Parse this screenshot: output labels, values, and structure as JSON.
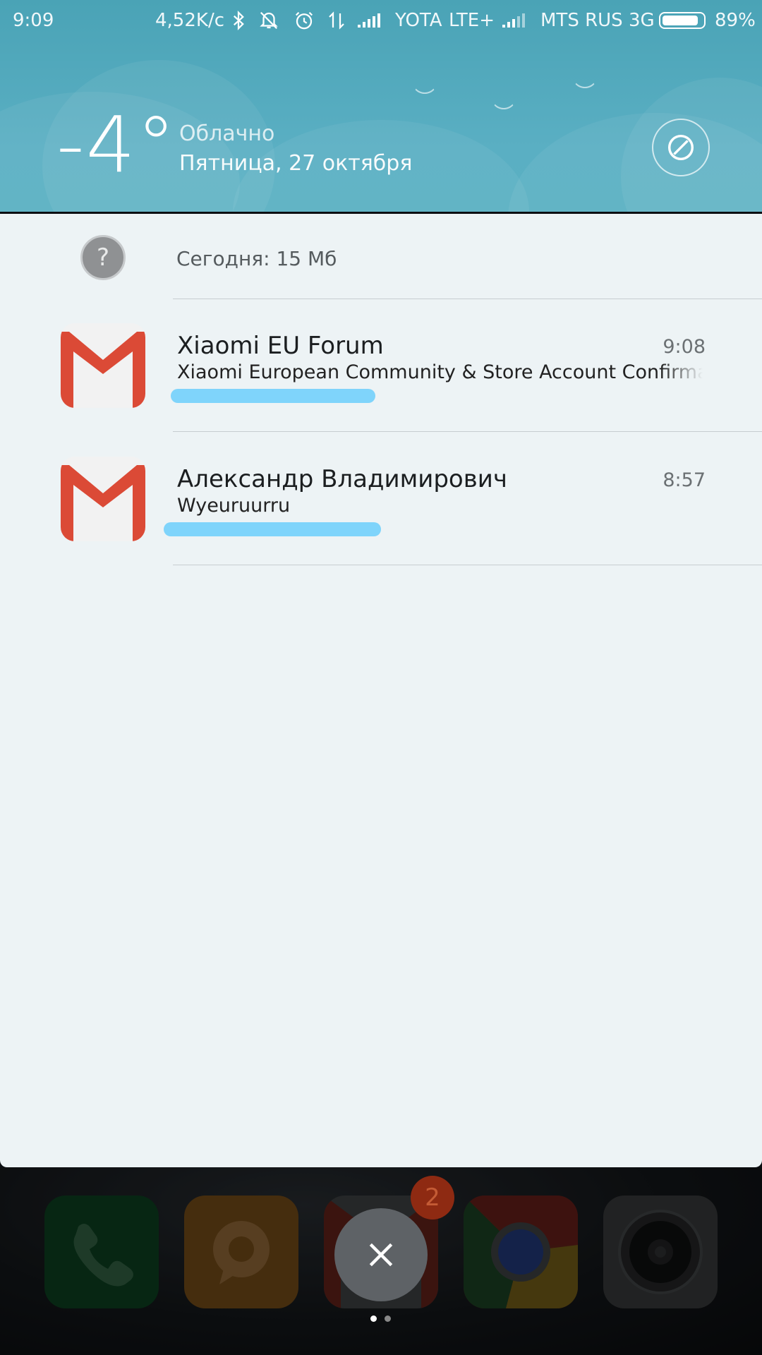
{
  "status_bar": {
    "time": "9:09",
    "speed": "4,52K/c",
    "carrier1": "YOTA",
    "network1": "LTE+",
    "carrier2": "MTS RUS 3G",
    "battery": "89%",
    "battery_level": 0.89
  },
  "weather": {
    "temperature": "-4°",
    "condition": "Облачно",
    "date": "Пятница, 27 октября"
  },
  "data_usage": {
    "text": "Сегодня: 15 Мб"
  },
  "notifications": [
    {
      "title": "Xiaomi EU Forum",
      "time": "9:08",
      "body": "Xiaomi European Community & Store Account Confirmation"
    },
    {
      "title": "Александр Владимирович",
      "time": "8:57",
      "body": "Wyeuruurru"
    }
  ],
  "dock": {
    "apps": [
      "phone-icon",
      "messages-icon",
      "gmail-icon",
      "chrome-icon",
      "camera-icon"
    ],
    "gmail_badge": "2"
  },
  "colors": {
    "header": "#55abbe",
    "panel": "#edf3f5",
    "gmail_red": "#db4a36",
    "redaction": "#7fd4fb"
  }
}
